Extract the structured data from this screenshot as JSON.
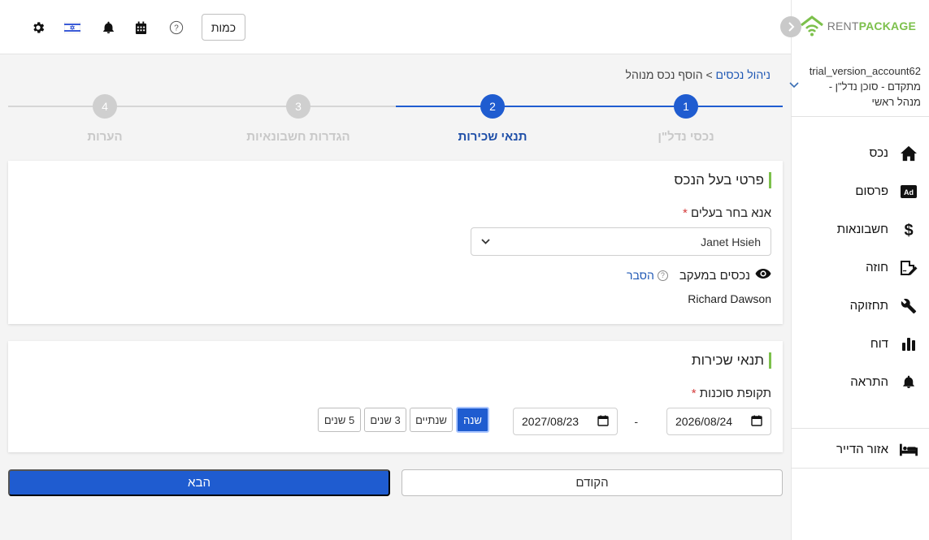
{
  "brand": {
    "rent": "RENT",
    "package": "PACKAGE",
    "green": "#7cc04b"
  },
  "account": {
    "name": "trial_version_account62",
    "role": "מתקדם - סוכן נדל\"ן - מנהל ראשי"
  },
  "nav": [
    {
      "label": "נכס",
      "icon": "home-icon"
    },
    {
      "label": "פרסום",
      "icon": "ad-icon"
    },
    {
      "label": "חשבונאות",
      "icon": "dollar-icon"
    },
    {
      "label": "חוזה",
      "icon": "contract-icon"
    },
    {
      "label": "תחזוקה",
      "icon": "wrench-icon"
    },
    {
      "label": "דוח",
      "icon": "bar-chart-icon"
    },
    {
      "label": "התראה",
      "icon": "bell-icon"
    }
  ],
  "tenant_area": {
    "label": "אזור הדייר",
    "icon": "bed-icon"
  },
  "topbar": {
    "quantity_label": "כמות"
  },
  "breadcrumb": {
    "link": "ניהול נכסים",
    "separator": ">",
    "current": "הוסף נכס מנוהל"
  },
  "steps": [
    {
      "number": "1",
      "label": "נכסי נדל\"ן",
      "state": "done"
    },
    {
      "number": "2",
      "label": "תנאי שכירות",
      "state": "active"
    },
    {
      "number": "3",
      "label": "הגדרות חשבונאיות",
      "state": "pending"
    },
    {
      "number": "4",
      "label": "הערות",
      "state": "pending"
    }
  ],
  "owner_card": {
    "title": "פרטי בעל הנכס",
    "select_label": "אנא בחר בעלים",
    "required_mark": "*",
    "selected_owner": "Janet Hsieh",
    "tracked_label": "נכסים במעקב",
    "help_label": "הסבר",
    "help_icon": "?",
    "tracked_person": "Richard Dawson"
  },
  "lease_card": {
    "title": "תנאי שכירות",
    "period_label": "תקופת סוכנות",
    "required_mark": "*",
    "start_date": "2026/08/24",
    "end_date": "2027/08/23",
    "separator": "-",
    "period_options": [
      "שנה",
      "שנתיים",
      "3 שנים",
      "5 שנים"
    ],
    "selected_period": "שנה"
  },
  "actions": {
    "next": "הבא",
    "previous": "הקודם"
  },
  "colors": {
    "primary": "#1f5cd0",
    "inactive_step": "#c8c8c8",
    "link": "#1e57b4"
  }
}
